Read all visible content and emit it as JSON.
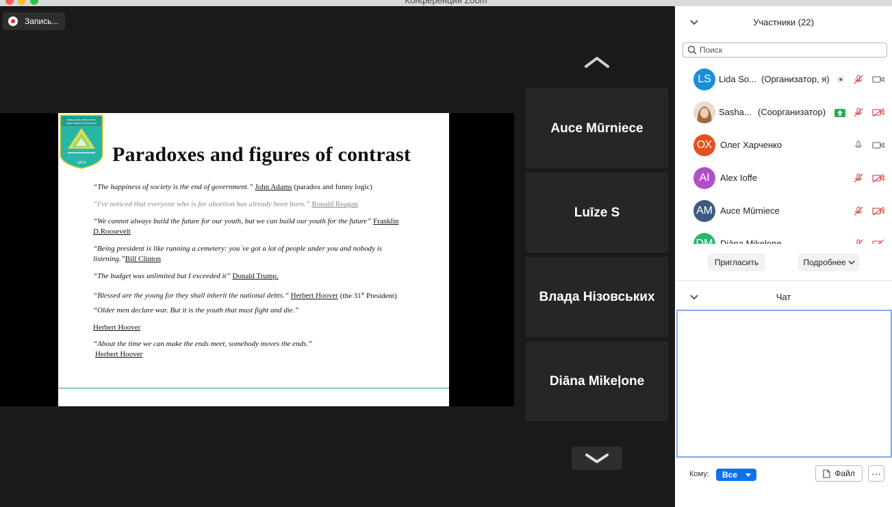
{
  "window": {
    "title": "Конференция Zoom"
  },
  "recording": {
    "label": "Запись..."
  },
  "slide": {
    "title": "Paradoxes and figures of contrast",
    "q1": {
      "quote": "“The happiness of society is the end of government.”",
      "author": "John Adams",
      "note": "(paradox  and funny logic)"
    },
    "q2": {
      "quote": "“I've noticed that everyone who is for abortion has already been born.”",
      "author": "Ronald Reagan"
    },
    "q3": {
      "quote": "“We cannot always build the future for our youth, but we can build our youth for the future”",
      "author1": "Franklin",
      "author2": "D.Roosevelt"
    },
    "q4": {
      "quote1": "“Being president is like running a cemetery: you`ve got a lot of people under you and nobody is",
      "quote2": "listening.”",
      "author": "Bill Clinton"
    },
    "q5": {
      "quote": "“The budget was unlimited but I exceeded it”",
      "author": "Donald Trump."
    },
    "q6": {
      "quote": "“Blessed are the young for they shall inherit the national debts.”",
      "author": "Herbert Hoover",
      "note_prefix": "(the 31",
      "note_sup": "st",
      "note_suffix": " President)"
    },
    "q7": {
      "quote": "“Older men declare war. But it is the youth that must fight and die.”"
    },
    "q7_author": "Herbert Hoover",
    "q8": {
      "quote": "“About the time we can make the ends meet, somebody moves the ends.”",
      "author": "Herbert Hoover"
    },
    "logo_text": [
      "Київський університет",
      "імені Бориса Грінченка",
      "1874"
    ]
  },
  "video_tiles": [
    "Auce Mūrniece",
    "Luīze S",
    "Влада Нізовських",
    "Diāna Mikeļone"
  ],
  "participants_panel": {
    "title": "Участники (22)",
    "search_placeholder": "Поиск",
    "participants": [
      {
        "initials": "LS",
        "name": "Lida So...",
        "role": "(Организатор, я)",
        "avatar_color": "#1a8fd6"
      },
      {
        "initials": "",
        "name": "Sasha...",
        "role": "(Соорганизатор)",
        "avatar_color": "#b08c6e"
      },
      {
        "initials": "ОХ",
        "name": "Олег Харченко",
        "role": "",
        "avatar_color": "#e4501e"
      },
      {
        "initials": "AI",
        "name": "Alex Ioffe",
        "role": "",
        "avatar_color": "#b24fc8"
      },
      {
        "initials": "AM",
        "name": "Auce Mūrniece",
        "role": "",
        "avatar_color": "#3d5a80"
      },
      {
        "initials": "DM",
        "name": "Diāna Mikeļone",
        "role": "",
        "avatar_color": "#2bb573"
      }
    ],
    "invite_label": "Пригласить",
    "more_label": "Подробнее"
  },
  "chat": {
    "title": "Чат",
    "to_label": "Кому:",
    "to_value": "Все",
    "file_label": "Файл",
    "more_label": "···"
  }
}
